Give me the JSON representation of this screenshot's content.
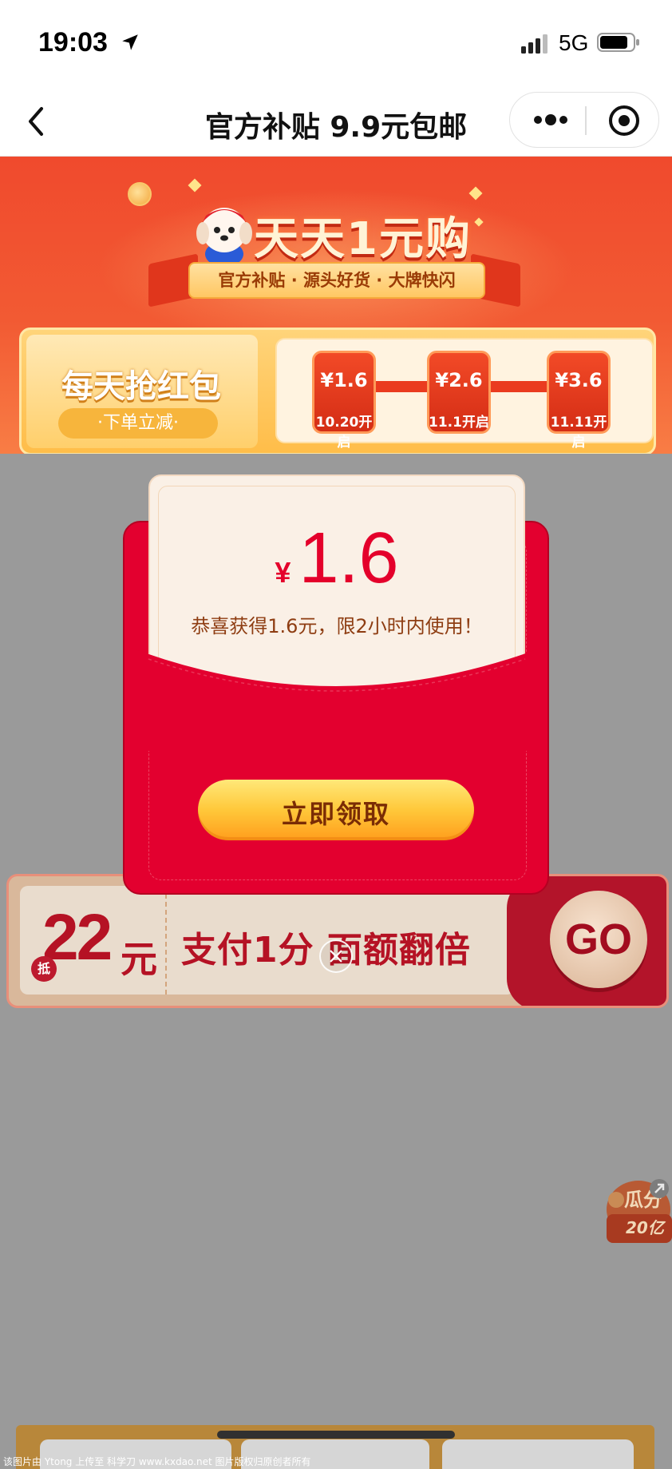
{
  "status_bar": {
    "time": "19:03",
    "network": "5G"
  },
  "nav": {
    "title": "官方补贴 9.9元包邮"
  },
  "banner": {
    "title": "天天1元购",
    "ribbon_text": "官方补贴 · 源头好货 · 大牌快闪",
    "daily": {
      "title": "每天抢红包",
      "subtitle": "·下单立减·",
      "stages": [
        {
          "value": "¥1.6",
          "date": "10.20开启"
        },
        {
          "value": "¥2.6",
          "date": "11.1开启"
        },
        {
          "value": "¥3.6",
          "date": "11.11开启"
        }
      ]
    }
  },
  "coupon": {
    "badge": "抵",
    "amount": "22",
    "unit": "元",
    "text": "支付1分 面额翻倍",
    "go_label": "GO"
  },
  "float_widget": {
    "text": "瓜分 20亿"
  },
  "popup": {
    "currency": "¥",
    "amount": "1.6",
    "message": "恭喜获得1.6元，限2小时内使用！",
    "button_label": "立即领取"
  },
  "watermark": "该图片由 Ytong 上传至 科学刀 www.kxdao.net 图片版权归原创者所有",
  "colors": {
    "packet_red": "#e3002f",
    "button_gold": "#ffc83a",
    "banner_red": "#f04a2d"
  }
}
